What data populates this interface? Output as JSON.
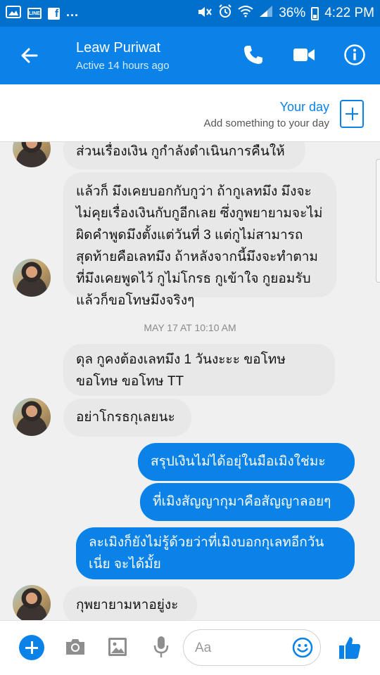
{
  "status_bar": {
    "app_icons": [
      "image-icon",
      "line-icon",
      "facebook-icon"
    ],
    "line_label": "LINE",
    "fb_label": "f",
    "overflow": "...",
    "system_icons": [
      "mute-icon",
      "alarm-icon",
      "wifi-icon",
      "signal-icon"
    ],
    "battery": "36%",
    "time": "4:22 PM"
  },
  "header": {
    "contact_name": "Leaw Puriwat",
    "active_status": "Active 14 hours ago",
    "icons": [
      "back-arrow-icon",
      "phone-icon",
      "video-camera-icon",
      "info-icon"
    ]
  },
  "your_day": {
    "title": "Your day",
    "subtitle": "Add something to your day"
  },
  "messages": [
    {
      "side": "in",
      "text": "ส่วนเรื่องเงิน กูกำลังดำเนินการคืนให้"
    },
    {
      "side": "in",
      "text": "แล้วก็ มึงเคยบอกกับกูว่า ถ้ากูเลทมึง มึงจะไม่คุยเรื่องเงินกับกูอีกเลย ซึ่งกูพยายามจะไม่ผิดคำพูดมึงตั้งแต่วันที่ 3 แต่กูไม่สามารถ สุดท้ายคือเลทมึง ถ้าหลังจากนี้มึงจะทำตามที่มึงเคยพูดไว้ กูไม่โกรธ กูเข้าใจ กูยอมรับ แล้วก็ขอโทษมึงจริงๆ"
    },
    {
      "side": "in",
      "text": "ดุล กูคงต้องเลทมึง 1 วันงะะะ ขอโทษขอโทษ ขอโทษ TT"
    },
    {
      "side": "in",
      "text": "อย่าโกรธกุเลยนะ"
    },
    {
      "side": "out",
      "text": "สรุปเงินไม่ได้อยุ่ในมือเมิงใช่มะ"
    },
    {
      "side": "out",
      "text": "ที่เมิงสัญญากุมาคือสัญญาลอยๆ"
    },
    {
      "side": "out",
      "text": "ละเมิงก็ยังไม่รู้ด้วยว่าที่เมิงบอกกุเลทอีกวันเนี่ย จะได้มั้ย"
    },
    {
      "side": "in",
      "text": "กุพยายามหาอยู่งะ"
    }
  ],
  "timestamp": "MAY 17 AT 10:10 AM",
  "composer": {
    "placeholder": "Aa",
    "icons": [
      "plus-icon",
      "camera-icon",
      "image-icon",
      "microphone-icon",
      "emoji-icon",
      "thumbs-up-icon"
    ]
  },
  "colors": {
    "status_bar": "#0070cc",
    "header": "#0a82e8",
    "incoming_bubble": "#e8e8e8",
    "outgoing_bubble": "#0a82e8",
    "background": "#f0f0f0"
  }
}
